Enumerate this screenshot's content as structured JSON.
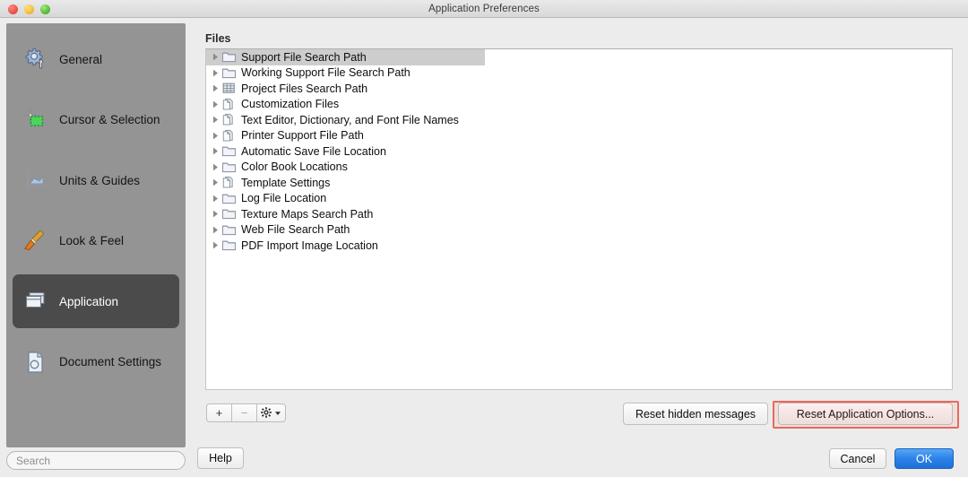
{
  "window": {
    "title": "Application Preferences",
    "traffic_lights": [
      {
        "name": "close",
        "color": "#ef5350"
      },
      {
        "name": "minimize",
        "color": "#f7c142"
      },
      {
        "name": "maximize",
        "color": "#5cc33c"
      }
    ]
  },
  "sidebar": {
    "items": [
      {
        "label": "General",
        "icon": "gear-wrench-icon",
        "selected": false
      },
      {
        "label": "Cursor & Selection",
        "icon": "crosshair-marquee-icon",
        "selected": false
      },
      {
        "label": "Units & Guides",
        "icon": "axis-ruler-icon",
        "selected": false
      },
      {
        "label": "Look & Feel",
        "icon": "paintbrush-icon",
        "selected": false
      },
      {
        "label": "Application",
        "icon": "stacked-windows-icon",
        "selected": true
      },
      {
        "label": "Document Settings",
        "icon": "document-page-icon",
        "selected": false
      }
    ],
    "search": {
      "value": "",
      "placeholder": "Search"
    }
  },
  "main": {
    "section_label": "Files",
    "rows": [
      {
        "label": "Support File Search Path",
        "icon": "folder-icon",
        "selected": true,
        "expanded": false
      },
      {
        "label": "Working Support File Search Path",
        "icon": "folder-icon",
        "selected": false,
        "expanded": false
      },
      {
        "label": "Project Files Search Path",
        "icon": "grid-icon",
        "selected": false,
        "expanded": false
      },
      {
        "label": "Customization Files",
        "icon": "document-icon",
        "selected": false,
        "expanded": false
      },
      {
        "label": "Text Editor, Dictionary, and Font File Names",
        "icon": "document-icon",
        "selected": false,
        "expanded": false
      },
      {
        "label": "Printer Support File Path",
        "icon": "document-icon",
        "selected": false,
        "expanded": false
      },
      {
        "label": "Automatic Save File Location",
        "icon": "folder-icon",
        "selected": false,
        "expanded": false
      },
      {
        "label": "Color Book Locations",
        "icon": "folder-icon",
        "selected": false,
        "expanded": false
      },
      {
        "label": "Template Settings",
        "icon": "document-icon",
        "selected": false,
        "expanded": false
      },
      {
        "label": "Log File Location",
        "icon": "folder-icon",
        "selected": false,
        "expanded": false
      },
      {
        "label": "Texture Maps Search Path",
        "icon": "folder-icon",
        "selected": false,
        "expanded": false
      },
      {
        "label": "Web File Search Path",
        "icon": "folder-icon",
        "selected": false,
        "expanded": false
      },
      {
        "label": "PDF Import Image Location",
        "icon": "folder-icon",
        "selected": false,
        "expanded": false
      }
    ]
  },
  "toolbar": {
    "add_label": "+",
    "remove_label": "−",
    "gear_label": "gear-dropdown-icon",
    "reset_hidden_label": "Reset hidden messages",
    "reset_app_label": "Reset Application Options...",
    "annotation_color": "#e8685c"
  },
  "footer": {
    "help_label": "Help",
    "cancel_label": "Cancel",
    "ok_label": "OK",
    "ok_color": "#2b82e8"
  }
}
